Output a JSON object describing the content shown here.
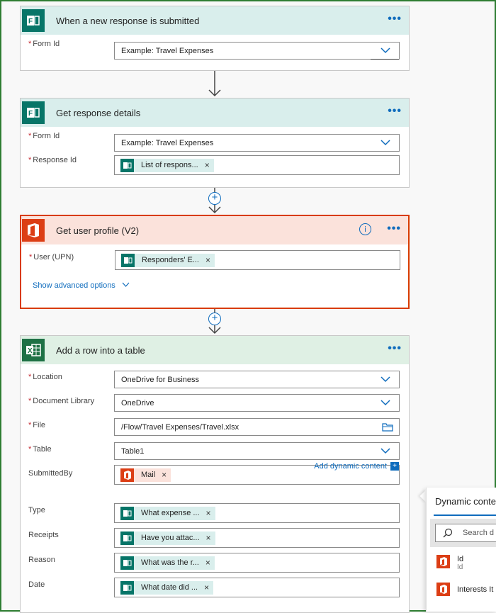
{
  "colors": {
    "accent": "#0f6cbd",
    "forms_teal": "#077568",
    "office_red": "#dc3e15",
    "excel_green": "#1e7145",
    "required": "#c4262e"
  },
  "cards": {
    "trigger": {
      "icon": "forms-icon",
      "title": "When a new response is submitted",
      "fields": [
        {
          "label": "Form Id",
          "required": true,
          "value": "Example: Travel Expenses"
        }
      ]
    },
    "get_response": {
      "icon": "forms-icon",
      "title": "Get response details",
      "fields": [
        {
          "label": "Form Id",
          "required": true,
          "value": "Example: Travel Expenses"
        },
        {
          "label": "Response Id",
          "required": true,
          "token": "List of respons..."
        }
      ]
    },
    "get_user": {
      "icon": "office-icon",
      "title": "Get user profile (V2)",
      "info_label": "i",
      "fields": [
        {
          "label": "User (UPN)",
          "required": true,
          "token": "Responders' E..."
        }
      ],
      "advanced_label": "Show advanced options"
    },
    "add_row": {
      "icon": "excel-icon",
      "title": "Add a row into a table",
      "fields": [
        {
          "label": "Location",
          "required": true,
          "value": "OneDrive for Business"
        },
        {
          "label": "Document Library",
          "required": true,
          "value": "OneDrive"
        },
        {
          "label": "File",
          "required": true,
          "value": "/Flow/Travel Expenses/Travel.xlsx"
        },
        {
          "label": "Table",
          "required": true,
          "value": "Table1"
        },
        {
          "label": "SubmittedBy",
          "required": false,
          "token": "Mail"
        },
        {
          "label": "Type",
          "required": false,
          "token": "What expense ..."
        },
        {
          "label": "Receipts",
          "required": false,
          "token": "Have you attac..."
        },
        {
          "label": "Reason",
          "required": false,
          "token": "What was the r..."
        },
        {
          "label": "Date",
          "required": false,
          "token": "What date did ..."
        }
      ],
      "dynamic_link": "Add dynamic content",
      "dynamic_plus": "+"
    }
  },
  "required_mark": "*",
  "menu_dots": "•••",
  "remove_mark": "×",
  "plus_mark": "+",
  "flyout": {
    "title": "Dynamic conte",
    "search_placeholder": "Search d",
    "items": [
      {
        "label": "Id",
        "sublabel": "Id"
      },
      {
        "label": "Interests It"
      }
    ]
  }
}
